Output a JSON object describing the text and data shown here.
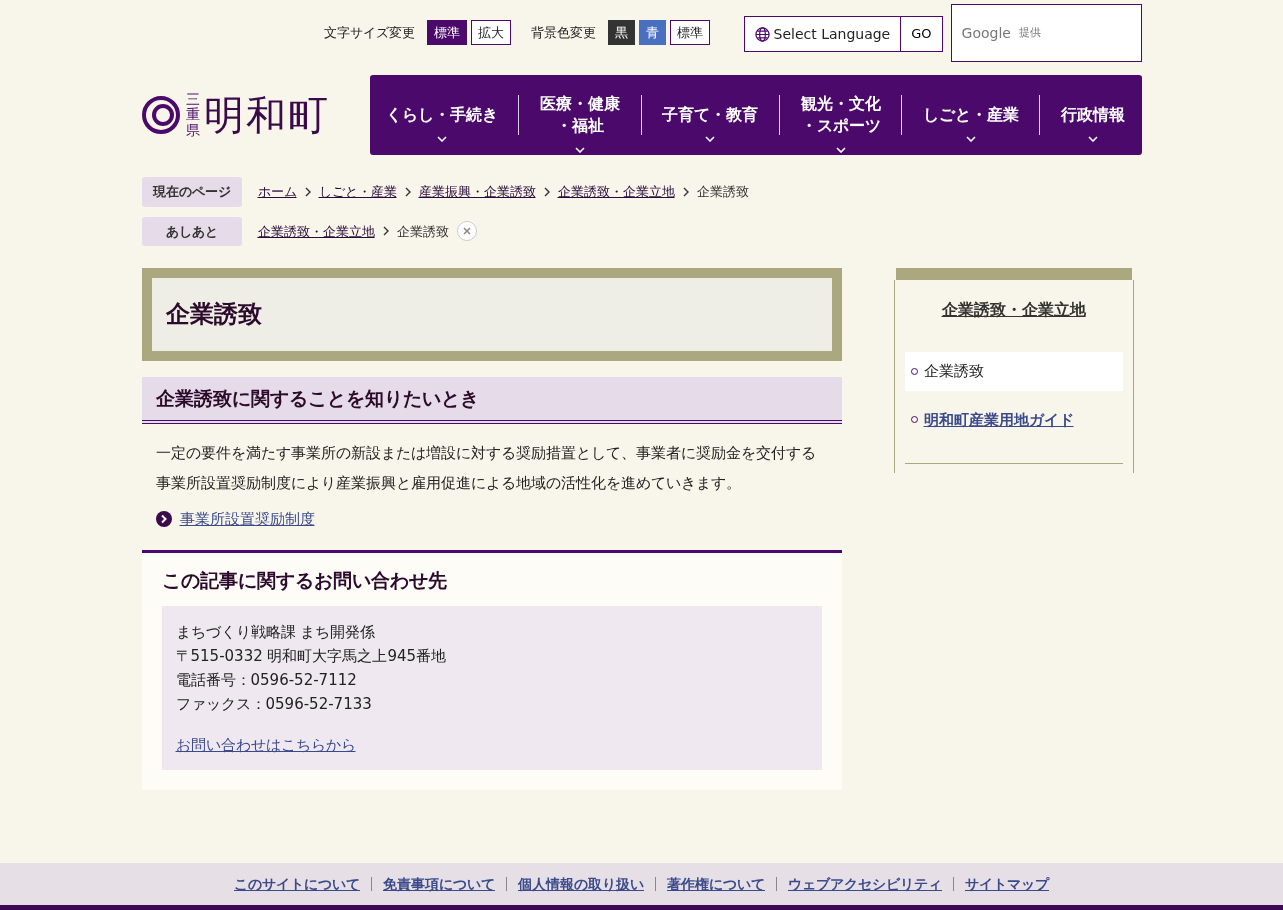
{
  "utility": {
    "font_size": {
      "label": "文字サイズ変更",
      "options": [
        {
          "label": "標準",
          "selected": true
        },
        {
          "label": "拡大",
          "selected": false
        }
      ]
    },
    "bg_color": {
      "label": "背景色変更",
      "options": [
        {
          "label": "黒",
          "kind": "black"
        },
        {
          "label": "青",
          "kind": "blue"
        },
        {
          "label": "標準",
          "kind": "standard"
        }
      ]
    },
    "language": {
      "label": "Select Language",
      "button": "GO"
    },
    "search": {
      "brand": "Google",
      "suffix": "提供"
    }
  },
  "logo": {
    "prefecture": "三重県",
    "town": "明和町"
  },
  "nav": [
    {
      "lines": [
        "くらし・手続き"
      ]
    },
    {
      "lines": [
        "医療・健康",
        "・福祉"
      ]
    },
    {
      "lines": [
        "子育て・教育"
      ]
    },
    {
      "lines": [
        "観光・文化",
        "・スポーツ"
      ]
    },
    {
      "lines": [
        "しごと・産業"
      ]
    },
    {
      "lines": [
        "行政情報"
      ]
    }
  ],
  "breadcrumb": {
    "label": "現在のページ",
    "items": [
      {
        "text": "ホーム",
        "link": true
      },
      {
        "text": "しごと・産業",
        "link": true
      },
      {
        "text": "産業振興・企業誘致",
        "link": true
      },
      {
        "text": "企業誘致・企業立地",
        "link": true
      },
      {
        "text": "企業誘致",
        "link": false
      }
    ]
  },
  "history": {
    "label": "あしあと",
    "items": [
      {
        "text": "企業誘致・企業立地",
        "link": true
      },
      {
        "text": "企業誘致",
        "link": false
      }
    ]
  },
  "page_title": "企業誘致",
  "section": {
    "heading": "企業誘致に関することを知りたいとき",
    "body": "一定の要件を満たす事業所の新設または増設に対する奨励措置として、事業者に奨励金を交付する事業所設置奨励制度により産業振興と雇用促進による地域の活性化を進めていきます。",
    "link": "事業所設置奨励制度"
  },
  "contact": {
    "title": "この記事に関するお問い合わせ先",
    "lines": [
      "まちづくり戦略課 まち開発係",
      "〒515-0332 明和町大字馬之上945番地",
      "電話番号：0596-52-7112",
      "ファックス：0596-52-7133"
    ],
    "link": "お問い合わせはこちらから"
  },
  "sidebar": {
    "title": "企業誘致・企業立地",
    "items": [
      {
        "label": "企業誘致",
        "selected": true
      },
      {
        "label": "明和町産業用地ガイド",
        "selected": false
      }
    ]
  },
  "footer": [
    "このサイトについて",
    "免責事項について",
    "個人情報の取り扱い",
    "著作権について",
    "ウェブアクセシビリティ",
    "サイトマップ"
  ]
}
